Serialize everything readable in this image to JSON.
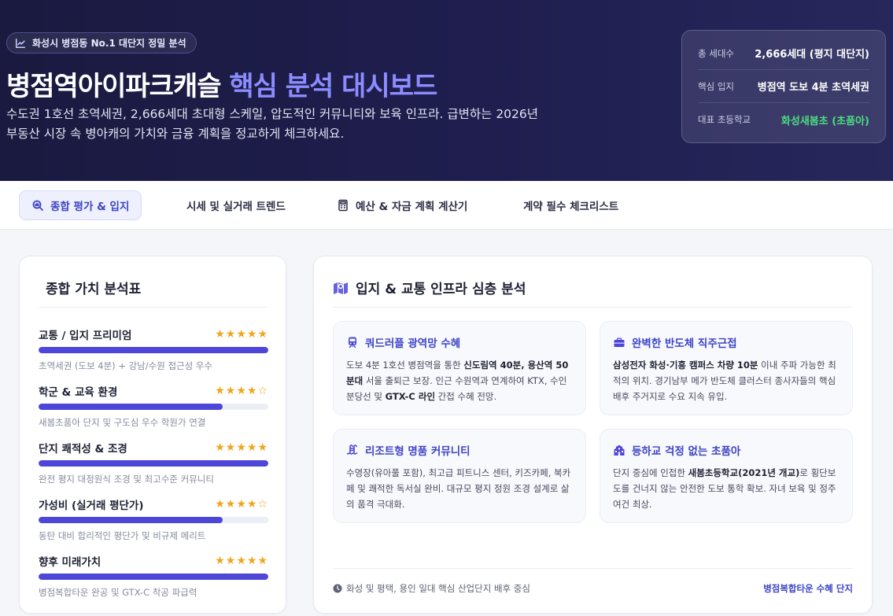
{
  "hero": {
    "badge": "화성시 병점동 No.1 대단지 정밀 분석",
    "title_main": "병점역아이파크캐슬",
    "title_highlight": "핵심 분석 대시보드",
    "description": "수도권 1호선 초역세권, 2,666세대 초대형 스케일, 압도적인 커뮤니티와 보육 인프라. 급변하는 2026년 부동산 시장 속 병아캐의 가치와 금융 계획을 정교하게 체크하세요.",
    "stats": [
      {
        "label": "총 세대수",
        "value": "2,666세대 (평지 대단지)"
      },
      {
        "label": "핵심 입지",
        "value": "병점역 도보 4분 초역세권"
      },
      {
        "label": "대표 초등학교",
        "value": "화성새봄초 (초품아)"
      }
    ]
  },
  "tabs": [
    {
      "label": "종합 평가 & 입지",
      "icon": "search-chart-icon",
      "active": true
    },
    {
      "label": "시세 및 실거래 트렌드",
      "icon": "",
      "active": false
    },
    {
      "label": "예산 & 자금 계획 계산기",
      "icon": "calculator-icon",
      "active": false
    },
    {
      "label": "계약 필수 체크리스트",
      "icon": "",
      "active": false
    }
  ],
  "value_table": {
    "title": "종합 가치 분석표",
    "metrics": [
      {
        "name": "교통 / 입지 프리미엄",
        "stars": "★★★★★",
        "rating": 5,
        "max": 5,
        "desc": "초역세권 (도보 4분) + 강남/수원 접근성 우수"
      },
      {
        "name": "학군 & 교육 환경",
        "stars": "★★★★☆",
        "rating": 4,
        "max": 5,
        "desc": "새봄초품아 단지 및 구도심 우수 학원가 연결"
      },
      {
        "name": "단지 쾌적성 & 조경",
        "stars": "★★★★★",
        "rating": 5,
        "max": 5,
        "desc": "완전 평지 대정원식 조경 및 최고수준 커뮤니티"
      },
      {
        "name": "가성비 (실거래 평단가)",
        "stars": "★★★★☆",
        "rating": 4,
        "max": 5,
        "desc": "동탄 대비 합리적인 평단가 및 비규제 메리트"
      },
      {
        "name": "향후 미래가치",
        "stars": "★★★★★",
        "rating": 5,
        "max": 5,
        "desc": "병점복합타운 완공 및 GTX-C 착공 파급력"
      }
    ]
  },
  "infra": {
    "title": "입지 & 교통 인프라 심층 분석",
    "features": [
      {
        "title": "쿼드러플 광역망 수혜",
        "icon": "train-icon",
        "body": [
          {
            "t": "도보 4분 1호선 병점역을 통한 "
          },
          {
            "t": "신도림역 40분, 용산역 50분대",
            "b": true
          },
          {
            "t": " 서울 출퇴근 보장. 인근 수원역과 연계하여 KTX, 수인분당선 및 "
          },
          {
            "t": "GTX-C 라인",
            "b": true
          },
          {
            "t": " 간접 수혜 전망."
          }
        ]
      },
      {
        "title": "완벽한 반도체 직주근접",
        "icon": "briefcase-icon",
        "body": [
          {
            "t": "삼성전자 화성·기흥 캠퍼스 차량 10분",
            "b": true
          },
          {
            "t": " 이내 주파 가능한 최적의 위치. 경기남부 메가 반도체 클러스터 종사자들의 핵심 배후 주거지로 수요 지속 유입."
          }
        ]
      },
      {
        "title": "리조트형 명품 커뮤니티",
        "icon": "pool-icon",
        "body": [
          {
            "t": "수영장(유아풀 포함), 최고급 피트니스 센터, 키즈카페, 북카페 및 쾌적한 독서실 완비. 대규모 평지 정원 조경 설계로 삶의 품격 극대화."
          }
        ]
      },
      {
        "title": "등하교 걱정 없는 초품아",
        "icon": "school-icon",
        "body": [
          {
            "t": "단지 중심에 인접한 "
          },
          {
            "t": "새봄초등학교(2021년 개교)",
            "b": true
          },
          {
            "t": "로 횡단보도를 건너지 않는 안전한 도보 통학 확보. 자녀 보육 및 정주 여건 최상."
          }
        ]
      }
    ],
    "footer_left": "화성 및 평택, 용인 일대 핵심 산업단지 배후 중심",
    "footer_right": "병점복합타운 수혜 단지"
  }
}
